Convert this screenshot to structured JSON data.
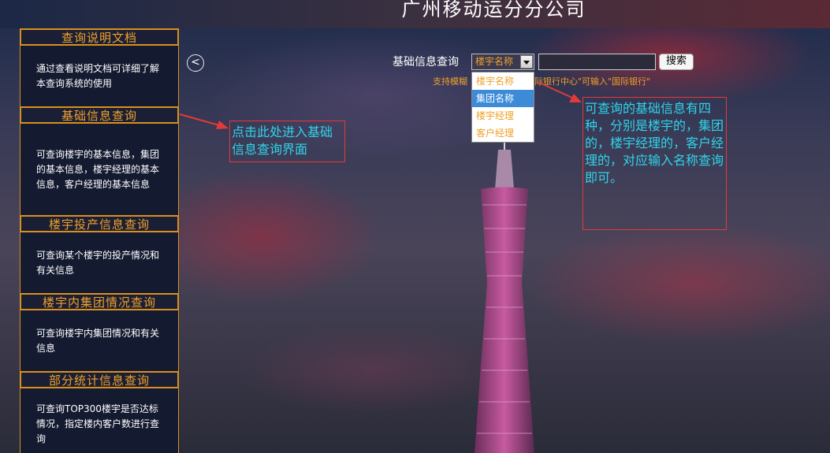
{
  "header": {
    "title": "广州移动运分分公司"
  },
  "sidebar": {
    "sections": [
      {
        "title": "查询说明文档",
        "desc": "通过查看说明文档可详细了解本查询系统的使用"
      },
      {
        "title": "基础信息查询",
        "desc": "可查询楼宇的基本信息，集团的基本信息，楼宇经理的基本信息，客户经理的基本信息"
      },
      {
        "title": "楼宇投产信息查询",
        "desc": "可查询某个楼宇的投产情况和有关信息"
      },
      {
        "title": "楼宇内集团情况查询",
        "desc": "可查询楼宇内集团情况和有关信息"
      },
      {
        "title": "部分统计信息查询",
        "desc": "可查询TOP300楼宇是否达标情况，指定楼内客户数进行查询"
      }
    ]
  },
  "query": {
    "back_icon": "<",
    "label": "基础信息查询",
    "selected": "楼宇名称",
    "options": [
      "楼宇名称",
      "集团名称",
      "楼宇经理",
      "客户经理"
    ],
    "highlighted_option": "集团名称",
    "input_value": "",
    "search_label": "搜索",
    "hint_left": "支持模糊",
    "hint_right": "际银行中心\"可输入\"国际银行\""
  },
  "annotations": {
    "note1": "点击此处进入基础信息查询界面",
    "note2": "可查询的基础信息有四种，分别是楼宇的，集团的，楼宇经理的，客户经理的，对应输入名称查询即可。"
  },
  "colors": {
    "accent": "#f0a02a",
    "annotation_border": "#e23a3a",
    "annotation_text": "#2fd4e8",
    "dropdown_highlight": "#3d8bd8"
  }
}
